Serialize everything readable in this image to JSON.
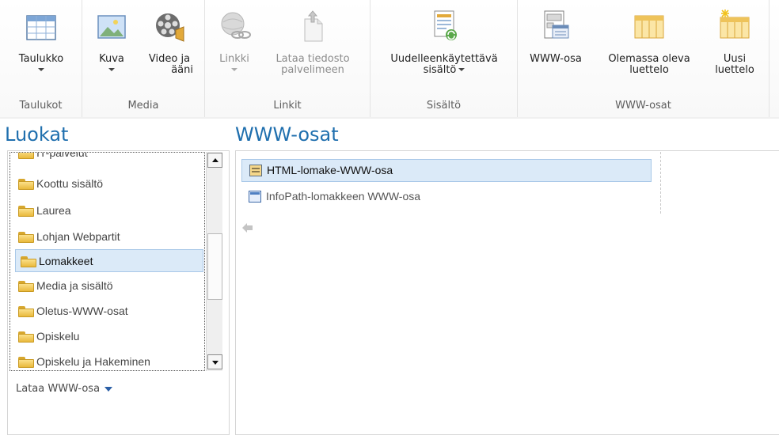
{
  "ribbon": {
    "groups": [
      {
        "title": "Taulukot",
        "buttons": [
          {
            "label": "Taulukko",
            "icon": "table-icon",
            "dropdown": true
          }
        ]
      },
      {
        "title": "Media",
        "buttons": [
          {
            "label": "Kuva",
            "icon": "picture-icon",
            "dropdown": true
          },
          {
            "label_line1": "Video ja",
            "label_line2": "ääni",
            "icon": "film-reel-icon"
          }
        ]
      },
      {
        "title": "Linkit",
        "buttons": [
          {
            "label": "Linkki",
            "icon": "globe-link-icon",
            "dropdown": true,
            "disabled": true
          },
          {
            "label_line1": "Lataa tiedosto",
            "label_line2": "palvelimeen",
            "icon": "upload-file-icon",
            "disabled": true
          }
        ]
      },
      {
        "title": "Sisältö",
        "buttons": [
          {
            "label_line1": "Uudelleenkäytettävä",
            "label_line2": "sisältö",
            "icon": "reusable-content-icon",
            "dropdown": true
          }
        ]
      },
      {
        "title": "WWW-osat",
        "buttons": [
          {
            "label": "WWW-osa",
            "icon": "webpart-icon"
          },
          {
            "label_line1": "Olemassa oleva",
            "label_line2": "luettelo",
            "icon": "existing-list-icon"
          },
          {
            "label_line1": "Uusi",
            "label_line2": "luettelo",
            "icon": "new-list-icon"
          }
        ]
      }
    ]
  },
  "left_heading": "Luokat",
  "right_heading": "WWW-osat",
  "categories": [
    {
      "label": "IT-palvelut"
    },
    {
      "label": "Koottu sisältö"
    },
    {
      "label": "Laurea"
    },
    {
      "label": "Lohjan Webpartit"
    },
    {
      "label": "Lomakkeet",
      "selected": true
    },
    {
      "label": "Media ja sisältö"
    },
    {
      "label": "Oletus-WWW-osat"
    },
    {
      "label": "Opiskelu"
    },
    {
      "label": "Opiskelu ja Hakeminen"
    }
  ],
  "upload_webpart": "Lataa WWW-osa",
  "webparts": [
    {
      "label": "HTML-lomake-WWW-osa",
      "icon": "html-form-icon",
      "selected": true
    },
    {
      "label": "InfoPath-lomakkeen WWW-osa",
      "icon": "infopath-form-icon"
    }
  ],
  "colors": {
    "heading": "#1f6fae",
    "selection": "#dbeaf8",
    "selection_border": "#a9c8e8"
  }
}
